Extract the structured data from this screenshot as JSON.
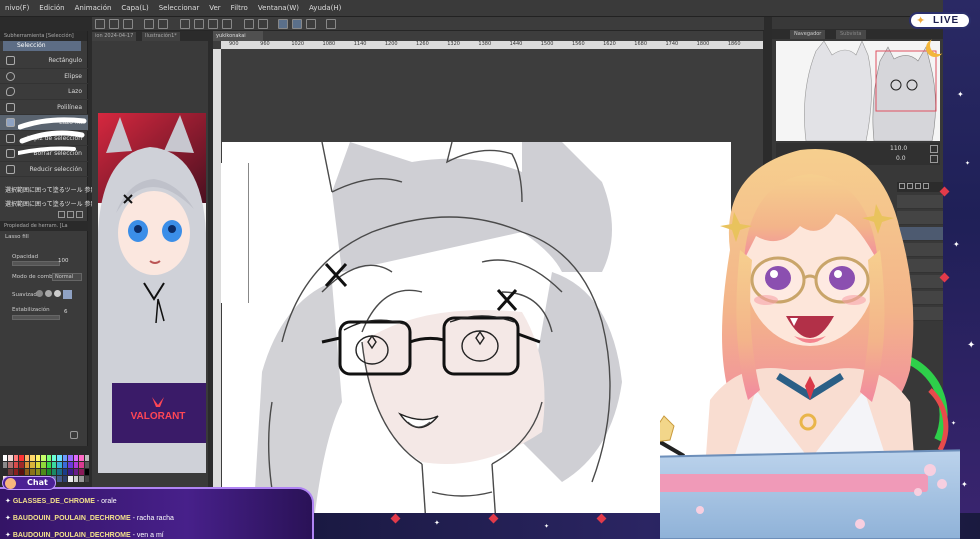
{
  "menu": {
    "items": [
      "nivo(F)",
      "Edición",
      "Animación",
      "Capa(L)",
      "Seleccionar",
      "Ver",
      "Filtro",
      "Ventana(W)",
      "Ayuda(H)"
    ]
  },
  "tool_panel": {
    "header": "Subherramienta [Selección]",
    "tab_label": "Selección",
    "tools": [
      {
        "label": "Rectángulo",
        "icon": "rectangle-select-icon"
      },
      {
        "label": "Elipse",
        "icon": "ellipse-select-icon"
      },
      {
        "label": "Lazo",
        "icon": "lasso-icon"
      },
      {
        "label": "Polilínea",
        "icon": "polyline-icon"
      },
      {
        "label": "Lazo fill",
        "icon": "lasso-fill-icon"
      },
      {
        "label": "Lápiz de selección",
        "icon": "selection-pen-icon"
      },
      {
        "label": "Borrar selección",
        "icon": "erase-selection-icon"
      },
      {
        "label": "Reducir selección",
        "icon": "shrink-selection-icon"
      }
    ],
    "aux_lines": [
      "選択範囲に囲って塗るツール 参照",
      "選択範囲に囲って塗るツール 参照"
    ],
    "properties_header": "Propiedad de herram. [La",
    "properties_title": "Lasso fill",
    "opacity_label": "Opacidad",
    "opacity_value": "100",
    "blend_label": "Modo de combina",
    "blend_value": "Normal",
    "antialias_label": "Suavizado",
    "stabilization_label": "Estabilización",
    "stabilization_value": "6"
  },
  "palette_colors": [
    "#ffffff",
    "#f2d7d5",
    "#ff7b7b",
    "#ff3333",
    "#ffb36b",
    "#ffd86b",
    "#fff36b",
    "#c6ff6b",
    "#7bff7b",
    "#6bffd6",
    "#6be0ff",
    "#6b9bff",
    "#9b6bff",
    "#e06bff",
    "#ff6bc6",
    "#bdbdbd",
    "#8a8a8a",
    "#b07070",
    "#d94a4a",
    "#a02828",
    "#d9903a",
    "#d9b33a",
    "#d9d93a",
    "#8fd93a",
    "#3ad94a",
    "#3ad9a0",
    "#3aaed9",
    "#3a6ad9",
    "#6a3ad9",
    "#b03ad9",
    "#d93a90",
    "#5a5a5a",
    "#2a2a2a",
    "#6b3b3b",
    "#8a2020",
    "#5a1010",
    "#8a5a1a",
    "#8a721a",
    "#8a8a1a",
    "#4e8a1a",
    "#1a8a2a",
    "#1a8a66",
    "#1a6a8a",
    "#1a3c8a",
    "#3c1a8a",
    "#6a1a8a",
    "#8a1a58",
    "#000000",
    "#f5e6d3",
    "#e8c8a8",
    "#d4a27a",
    "#b57a50",
    "#8c5433",
    "#5e3520",
    "#c9d6ea",
    "#a7b6d6",
    "#8496c0",
    "#6276a8",
    "#465a8e",
    "#2e3f6e",
    "#eeeeee",
    "#cccccc",
    "#999999",
    "#444444"
  ],
  "reference_panel": {
    "tabs": [
      "ion 2024-04-17",
      "Ilustración1*",
      "yukikonakai"
    ],
    "brand_text": "VALORANT"
  },
  "document": {
    "tab_label": "yukikonakai",
    "ruler_ticks": [
      "900",
      "960",
      "1020",
      "1080",
      "1140",
      "1200",
      "1260",
      "1320",
      "1380",
      "1440",
      "1500",
      "1560",
      "1620",
      "1680",
      "1740",
      "1800",
      "1860"
    ]
  },
  "navigator": {
    "tabs": [
      "Navegador",
      "Subvista"
    ],
    "zoom_value": "110.0",
    "angle_value": "0.0"
  },
  "chat": {
    "badge_label": "Chat",
    "messages": [
      {
        "user": "GLASSES_DE_CHROME",
        "text": "orale"
      },
      {
        "user": "BAUDOUIN_POULAIN_DECHROME",
        "text": "racha racha"
      },
      {
        "user": "BAUDOUIN_POULAIN_DECHROME",
        "text": "ven a mí"
      }
    ]
  },
  "live": {
    "label": "LIVE"
  },
  "colors": {
    "chat_bg": "#3a1672",
    "chat_border": "#b084f4",
    "chat_username": "#f3e18b",
    "live_text": "#1c1f4f",
    "accent_red": "#e23a4a",
    "starfield": "#23225d"
  }
}
